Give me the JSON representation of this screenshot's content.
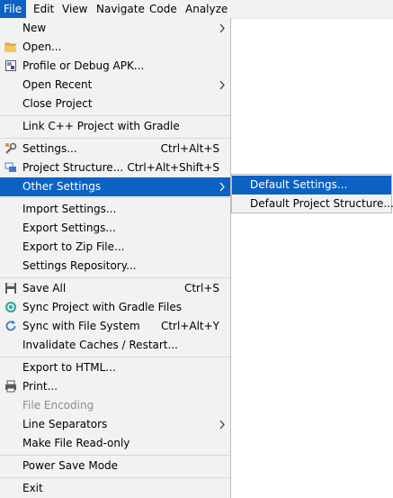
{
  "menubar": {
    "items": [
      {
        "label": "File"
      },
      {
        "label": "Edit"
      },
      {
        "label": "View"
      },
      {
        "label": "Navigate"
      },
      {
        "label": "Code"
      },
      {
        "label": "Analyze"
      }
    ]
  },
  "file_menu": {
    "items": [
      {
        "label": "New"
      },
      {
        "label": "Open..."
      },
      {
        "label": "Profile or Debug APK..."
      },
      {
        "label": "Open Recent"
      },
      {
        "label": "Close Project"
      },
      {
        "label": "Link C++ Project with Gradle"
      },
      {
        "label": "Settings...",
        "shortcut": "Ctrl+Alt+S"
      },
      {
        "label": "Project Structure...",
        "shortcut": "Ctrl+Alt+Shift+S"
      },
      {
        "label": "Other Settings"
      },
      {
        "label": "Import Settings..."
      },
      {
        "label": "Export Settings..."
      },
      {
        "label": "Export to Zip File..."
      },
      {
        "label": "Settings Repository..."
      },
      {
        "label": "Save All",
        "shortcut": "Ctrl+S"
      },
      {
        "label": "Sync Project with Gradle Files"
      },
      {
        "label": "Sync with File System",
        "shortcut": "Ctrl+Alt+Y"
      },
      {
        "label": "Invalidate Caches / Restart..."
      },
      {
        "label": "Export to HTML..."
      },
      {
        "label": "Print..."
      },
      {
        "label": "File Encoding"
      },
      {
        "label": "Line Separators"
      },
      {
        "label": "Make File Read-only"
      },
      {
        "label": "Power Save Mode"
      },
      {
        "label": "Exit"
      }
    ]
  },
  "other_settings_submenu": {
    "items": [
      {
        "label": "Default Settings..."
      },
      {
        "label": "Default Project Structure..."
      }
    ]
  },
  "colors": {
    "selection": "#0b62c3",
    "menu_background": "#f2f2f2",
    "disabled_text": "#8c8c8c"
  },
  "icons": {
    "open": "folder-icon",
    "profile_debug_apk": "apk-icon",
    "settings": "wrench-icon",
    "project_structure": "project-structure-icon",
    "save_all": "floppy-disk-icon",
    "sync_gradle": "gradle-sync-icon",
    "sync_fs": "refresh-icon",
    "print": "printer-icon"
  }
}
